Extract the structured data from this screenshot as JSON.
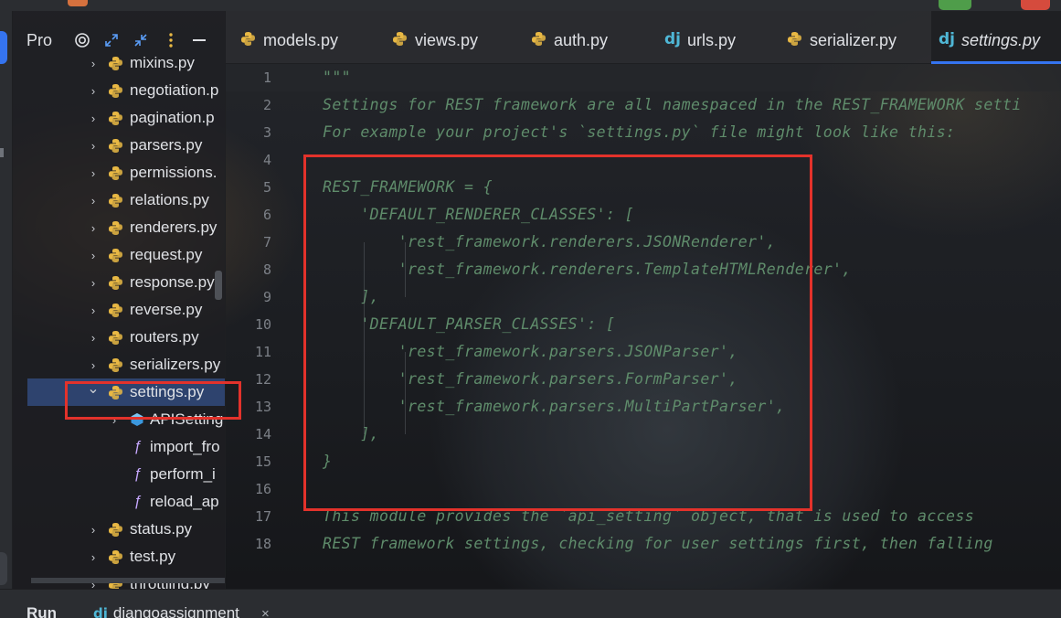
{
  "project_panel": {
    "title": "Pro",
    "tree": [
      {
        "label": "mixins.py",
        "type": "file",
        "expanded": false
      },
      {
        "label": "negotiation.p",
        "type": "file",
        "expanded": false
      },
      {
        "label": "pagination.p",
        "type": "file",
        "expanded": false
      },
      {
        "label": "parsers.py",
        "type": "file",
        "expanded": false
      },
      {
        "label": "permissions.",
        "type": "file",
        "expanded": false
      },
      {
        "label": "relations.py",
        "type": "file",
        "expanded": false
      },
      {
        "label": "renderers.py",
        "type": "file",
        "expanded": false
      },
      {
        "label": "request.py",
        "type": "file",
        "expanded": false
      },
      {
        "label": "response.py",
        "type": "file",
        "expanded": false
      },
      {
        "label": "reverse.py",
        "type": "file",
        "expanded": false
      },
      {
        "label": "routers.py",
        "type": "file",
        "expanded": false
      },
      {
        "label": "serializers.py",
        "type": "file",
        "expanded": false
      },
      {
        "label": "settings.py",
        "type": "file",
        "expanded": true,
        "selected": true
      },
      {
        "label": "APISetting",
        "type": "class"
      },
      {
        "label": "import_fro",
        "type": "function"
      },
      {
        "label": "perform_i",
        "type": "function"
      },
      {
        "label": "reload_ap",
        "type": "function"
      },
      {
        "label": "status.py",
        "type": "file",
        "expanded": false
      },
      {
        "label": "test.py",
        "type": "file",
        "expanded": false
      },
      {
        "label": "throttling.py",
        "type": "file",
        "expanded": false
      }
    ]
  },
  "tabs": [
    {
      "label": "models.py",
      "icon": "python-icon",
      "active": false
    },
    {
      "label": "views.py",
      "icon": "python-icon",
      "active": false
    },
    {
      "label": "auth.py",
      "icon": "python-icon",
      "active": false
    },
    {
      "label": "urls.py",
      "icon": "django-icon",
      "active": false
    },
    {
      "label": "serializer.py",
      "icon": "python-icon",
      "active": false
    },
    {
      "label": "settings.py",
      "icon": "django-icon",
      "active": true
    }
  ],
  "tab_icon_text": {
    "django": "dj"
  },
  "editor": {
    "lines": [
      {
        "n": "1",
        "text": "\"\"\""
      },
      {
        "n": "2",
        "text": "Settings for REST framework are all namespaced in the REST_FRAMEWORK setti"
      },
      {
        "n": "3",
        "text": "For example your project's `settings.py` file might look like this:"
      },
      {
        "n": "4",
        "text": ""
      },
      {
        "n": "5",
        "text": "REST_FRAMEWORK = {"
      },
      {
        "n": "6",
        "text": "    'DEFAULT_RENDERER_CLASSES': ["
      },
      {
        "n": "7",
        "text": "        'rest_framework.renderers.JSONRenderer',"
      },
      {
        "n": "8",
        "text": "        'rest_framework.renderers.TemplateHTMLRenderer',"
      },
      {
        "n": "9",
        "text": "    ],"
      },
      {
        "n": "10",
        "text": "    'DEFAULT_PARSER_CLASSES': ["
      },
      {
        "n": "11",
        "text": "        'rest_framework.parsers.JSONParser',"
      },
      {
        "n": "12",
        "text": "        'rest_framework.parsers.FormParser',"
      },
      {
        "n": "13",
        "text": "        'rest_framework.parsers.MultiPartParser',"
      },
      {
        "n": "14",
        "text": "    ],"
      },
      {
        "n": "15",
        "text": "}"
      },
      {
        "n": "16",
        "text": ""
      },
      {
        "n": "17",
        "text": "This module provides the `api_setting` object, that is used to access"
      },
      {
        "n": "18",
        "text": "REST framework settings, checking for user settings first, then falling"
      }
    ]
  },
  "bottom": {
    "run_label": "Run",
    "run_tab_label": "djangoassignment",
    "close_glyph": "×"
  },
  "colors": {
    "accent": "#3574f0",
    "annotation_red": "#e3322b",
    "docstring": "#5f8c6b",
    "selection": "#2e436e"
  }
}
